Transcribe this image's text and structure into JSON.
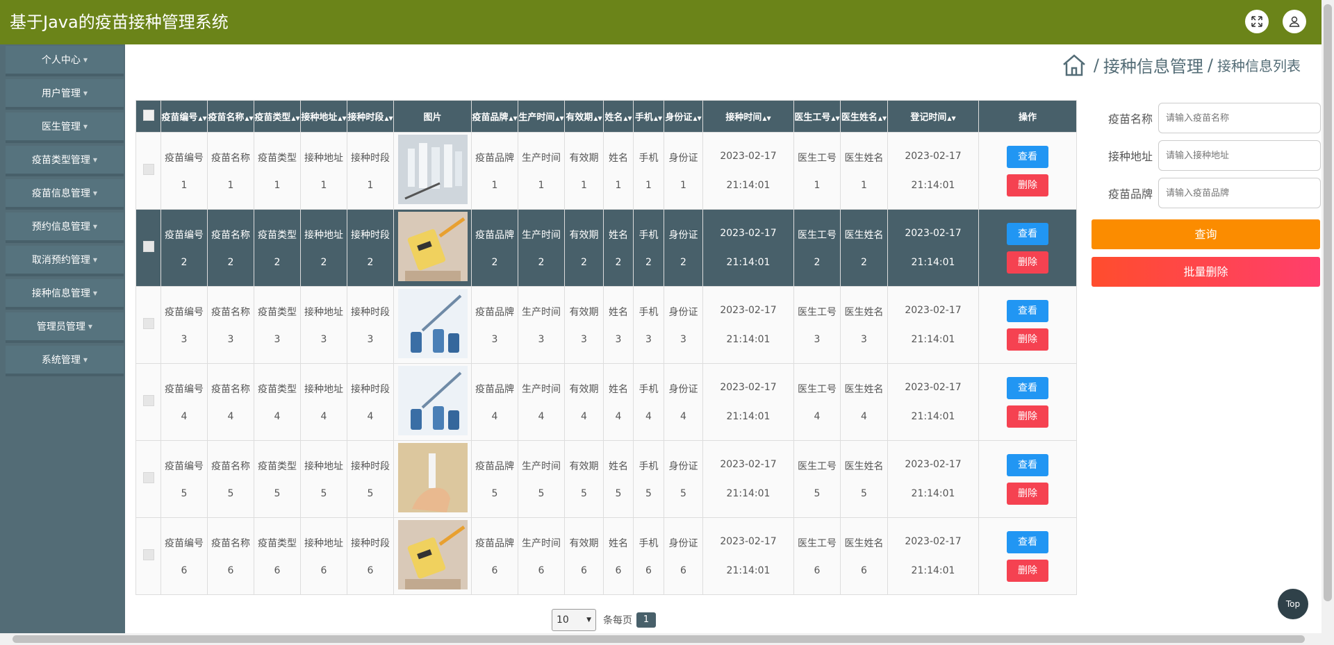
{
  "app": {
    "title": "基于Java的疫苗接种管理系统"
  },
  "sidebar": {
    "items": [
      {
        "label": "个人中心"
      },
      {
        "label": "用户管理"
      },
      {
        "label": "医生管理"
      },
      {
        "label": "疫苗类型管理"
      },
      {
        "label": "疫苗信息管理"
      },
      {
        "label": "预约信息管理"
      },
      {
        "label": "取消预约管理"
      },
      {
        "label": "接种信息管理"
      },
      {
        "label": "管理员管理"
      },
      {
        "label": "系统管理"
      }
    ]
  },
  "breadcrumb": {
    "sep": "/",
    "main": "接种信息管理",
    "sub": "接种信息列表"
  },
  "table": {
    "columns": [
      "疫苗编号",
      "疫苗名称",
      "疫苗类型",
      "接种地址",
      "接种时段",
      "图片",
      "疫苗品牌",
      "生产时间",
      "有效期",
      "姓名",
      "手机",
      "身份证",
      "接种时间",
      "医生工号",
      "医生姓名",
      "登记时间",
      "操作"
    ],
    "rows": [
      {
        "vals": [
          "1",
          "1",
          "1",
          "1",
          "1",
          "1",
          "1",
          "1",
          "1",
          "1",
          "1",
          "1",
          "1"
        ],
        "jz_date": "2023-02-17",
        "jz_time": "21:14:01",
        "dj_date": "2023-02-17",
        "dj_time": "21:14:01"
      },
      {
        "vals": [
          "2",
          "2",
          "2",
          "2",
          "2",
          "2",
          "2",
          "2",
          "2",
          "2",
          "2",
          "2",
          "2"
        ],
        "jz_date": "2023-02-17",
        "jz_time": "21:14:01",
        "dj_date": "2023-02-17",
        "dj_time": "21:14:01"
      },
      {
        "vals": [
          "3",
          "3",
          "3",
          "3",
          "3",
          "3",
          "3",
          "3",
          "3",
          "3",
          "3",
          "3",
          "3"
        ],
        "jz_date": "2023-02-17",
        "jz_time": "21:14:01",
        "dj_date": "2023-02-17",
        "dj_time": "21:14:01"
      },
      {
        "vals": [
          "4",
          "4",
          "4",
          "4",
          "4",
          "4",
          "4",
          "4",
          "4",
          "4",
          "4",
          "4",
          "4"
        ],
        "jz_date": "2023-02-17",
        "jz_time": "21:14:01",
        "dj_date": "2023-02-17",
        "dj_time": "21:14:01"
      },
      {
        "vals": [
          "5",
          "5",
          "5",
          "5",
          "5",
          "5",
          "5",
          "5",
          "5",
          "5",
          "5",
          "5",
          "5"
        ],
        "jz_date": "2023-02-17",
        "jz_time": "21:14:01",
        "dj_date": "2023-02-17",
        "dj_time": "21:14:01"
      },
      {
        "vals": [
          "6",
          "6",
          "6",
          "6",
          "6",
          "6",
          "6",
          "6",
          "6",
          "6",
          "6",
          "6",
          "6"
        ],
        "jz_date": "2023-02-17",
        "jz_time": "21:14:01",
        "dj_date": "2023-02-17",
        "dj_time": "21:14:01"
      }
    ],
    "view_label": "查看",
    "delete_label": "删除"
  },
  "search": {
    "fields": [
      {
        "label": "疫苗名称",
        "placeholder": "请输入疫苗名称"
      },
      {
        "label": "接种地址",
        "placeholder": "请输入接种地址"
      },
      {
        "label": "疫苗品牌",
        "placeholder": "请输入疫苗品牌"
      }
    ],
    "query_label": "查询",
    "batch_delete_label": "批量删除"
  },
  "pager": {
    "page_size": "10",
    "per_page_text": "条每页",
    "current_page": "1"
  },
  "top_label": "Top"
}
